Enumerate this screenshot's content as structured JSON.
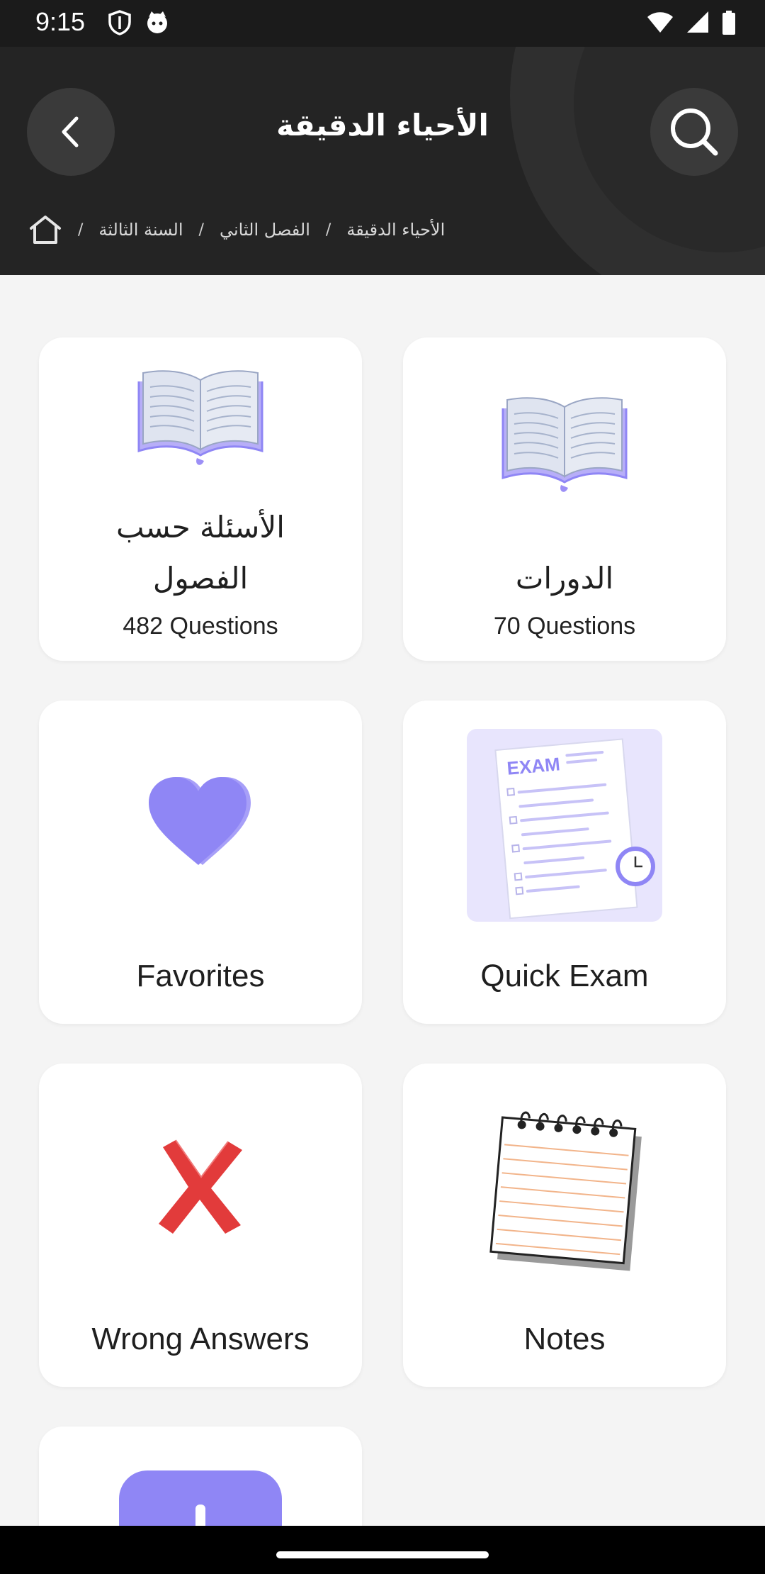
{
  "status": {
    "time": "9:15"
  },
  "header": {
    "title": "الأحياء الدقيقة",
    "breadcrumb": [
      "السنة الثالثة",
      "الفصل الثاني",
      "الأحياء الدقيقة"
    ],
    "separator": "/"
  },
  "cards": [
    {
      "title": "الأسئلة حسب الفصول",
      "title_line1": "الأسئلة حسب",
      "title_line2": "الفصول",
      "count": "482 Questions"
    },
    {
      "title": "الدورات",
      "count": "70 Questions"
    },
    {
      "title": "Favorites"
    },
    {
      "title": "Quick Exam"
    },
    {
      "title": "Wrong Answers"
    },
    {
      "title": "Notes"
    }
  ],
  "icons": {
    "book": "open-book-icon",
    "favorites": "heart-icon",
    "exam": "exam-paper-icon",
    "wrong": "x-mark-icon",
    "notes": "notepad-icon",
    "partial": "purple-box-icon"
  },
  "colors": {
    "accent": "#8f86f5",
    "header_bg": "#242424",
    "wrong_red": "#e23b3b",
    "page_bg": "#f4f4f4"
  }
}
